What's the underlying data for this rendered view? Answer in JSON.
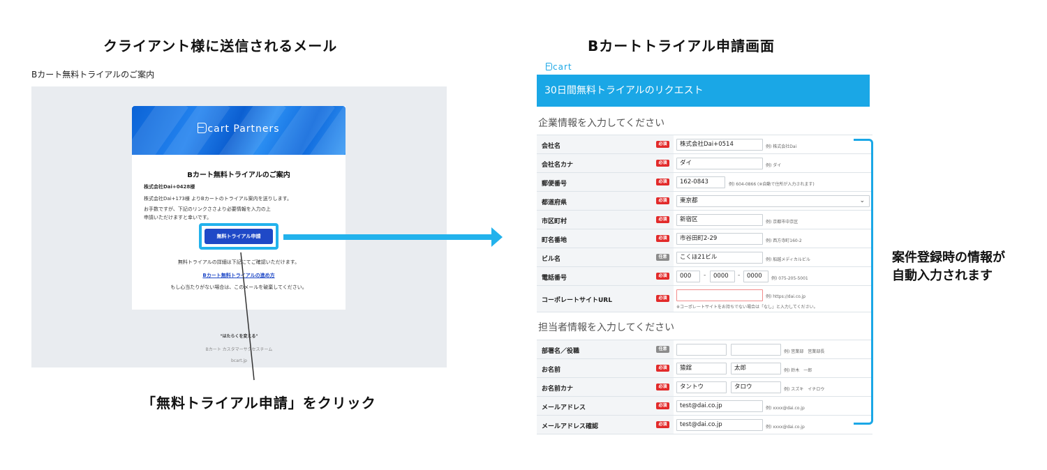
{
  "left_heading": "クライアント様に送信されるメール",
  "right_heading": "Bカートトライアル申請画面",
  "email": {
    "subject": "Bカート無料トライアルのご案内",
    "banner_logo": "cart Partners",
    "card_title": "Bカート無料トライアルのご案内",
    "recipient": "株式会社Dai+0428様",
    "body_line1": "株式会社Dai+173様 よりBカートのトライアル案内を送りします。",
    "body_line2": "お手数ですが、下記のリンクささより必要情報を入力の上",
    "body_line3": "申請いただけますと幸いです。",
    "button_label": "無料トライアル申請",
    "detail_text": "無料トライアルの詳細は下記にてご確認いただけます。",
    "link_text": "Bカート無料トライアルの進め方",
    "ignore_text": "もし心当たりがない場合は、このメールを破棄してください。",
    "footer_tagline": "\"はたらくを変える\"",
    "footer_team": "Bカート カスタマーサクセスチーム",
    "footer_url": "bcart.jp"
  },
  "click_caption": "「無料トライアル申請」をクリック",
  "form": {
    "logo": "cart",
    "header": "30日間無料トライアルのリクエスト",
    "section_company": "企業情報を入力してください",
    "section_contact": "担当者情報を入力してください",
    "required_badge": "必須",
    "optional_badge": "任意",
    "company_name": {
      "label": "会社名",
      "value": "株式会社Dai+0514",
      "example": "例) 株式会社Dai"
    },
    "company_kana": {
      "label": "会社名カナ",
      "value": "ダイ",
      "example": "例) ダイ"
    },
    "postal_code": {
      "label": "郵便番号",
      "value": "162-0843",
      "example": "例) 604-0866 (※自動で住所が入力されます)"
    },
    "prefecture": {
      "label": "都道府県",
      "value": "東京都"
    },
    "city": {
      "label": "市区町村",
      "value": "新宿区",
      "example": "例) 京都市中京区"
    },
    "street": {
      "label": "町名番地",
      "value": "市谷田町2-29",
      "example": "例) 西方寺町160-2"
    },
    "building": {
      "label": "ビル名",
      "value": "こくほ21ビル",
      "example": "例) 船越メディカルビル"
    },
    "phone": {
      "label": "電話番号",
      "part1": "000",
      "part2": "0000",
      "part3": "0000",
      "separator": "-",
      "example": "例) 075-205-5001"
    },
    "corporate_url": {
      "label": "コーポレートサイトURL",
      "value": "",
      "example": "例) https://dai.co.jp",
      "note": "※コーポレートサイトをお持ちでない場合は「なし」と入力してください。"
    },
    "department": {
      "label": "部署名／役職",
      "value1": "",
      "value2": "",
      "example": "例) 営業部　営業部長"
    },
    "name": {
      "label": "お名前",
      "last": "猿舘",
      "first": "太郎",
      "example": "例) 鈴木　一郎"
    },
    "name_kana": {
      "label": "お名前カナ",
      "last": "タントウ",
      "first": "タロウ",
      "example": "例) スズキ　イチロウ"
    },
    "email": {
      "label": "メールアドレス",
      "value": "test@dai.co.jp",
      "example": "例) xxxx@dai.co.jp"
    },
    "email_confirm": {
      "label": "メールアドレス確認",
      "value": "test@dai.co.jp",
      "example": "例) xxxx@dai.co.jp"
    }
  },
  "auto_caption_line1": "案件登録時の情報が",
  "auto_caption_line2": "自動入力されます",
  "colors": {
    "accent": "#1aa7e6",
    "button": "#1f49c7",
    "required": "#e22a2a",
    "optional": "#8b8b8b"
  }
}
